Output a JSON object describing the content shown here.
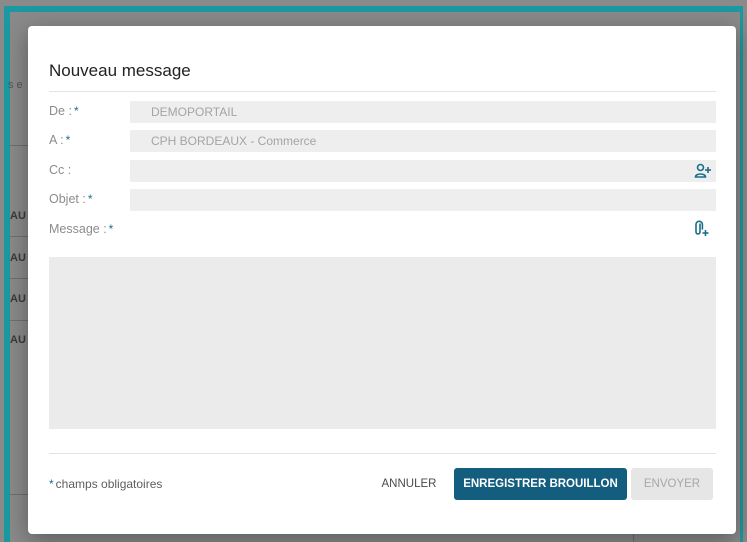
{
  "modal": {
    "title": "Nouveau message",
    "fields": [
      {
        "label": "De :",
        "required": true,
        "value": "DEMOPORTAIL"
      },
      {
        "label": "A :",
        "required": true,
        "value": "CPH BORDEAUX - Commerce"
      },
      {
        "label": "Cc :",
        "required": false,
        "value": ""
      },
      {
        "label": "Objet :",
        "required": true,
        "value": ""
      }
    ],
    "message_label": "Message :",
    "required_star": "*",
    "required_note": "champs obligatoires",
    "buttons": {
      "cancel": "ANNULER",
      "save": "ENREGISTRER BROUILLON",
      "send": "ENVOYER"
    }
  },
  "background": {
    "fragments": [
      "s e",
      "AU",
      "AU",
      "AU",
      "AU"
    ]
  },
  "colors": {
    "accent": "#135d7e",
    "frame": "#1a9aa0"
  },
  "icons": {
    "cc": "add-contact-icon",
    "message": "attach-file-icon"
  }
}
